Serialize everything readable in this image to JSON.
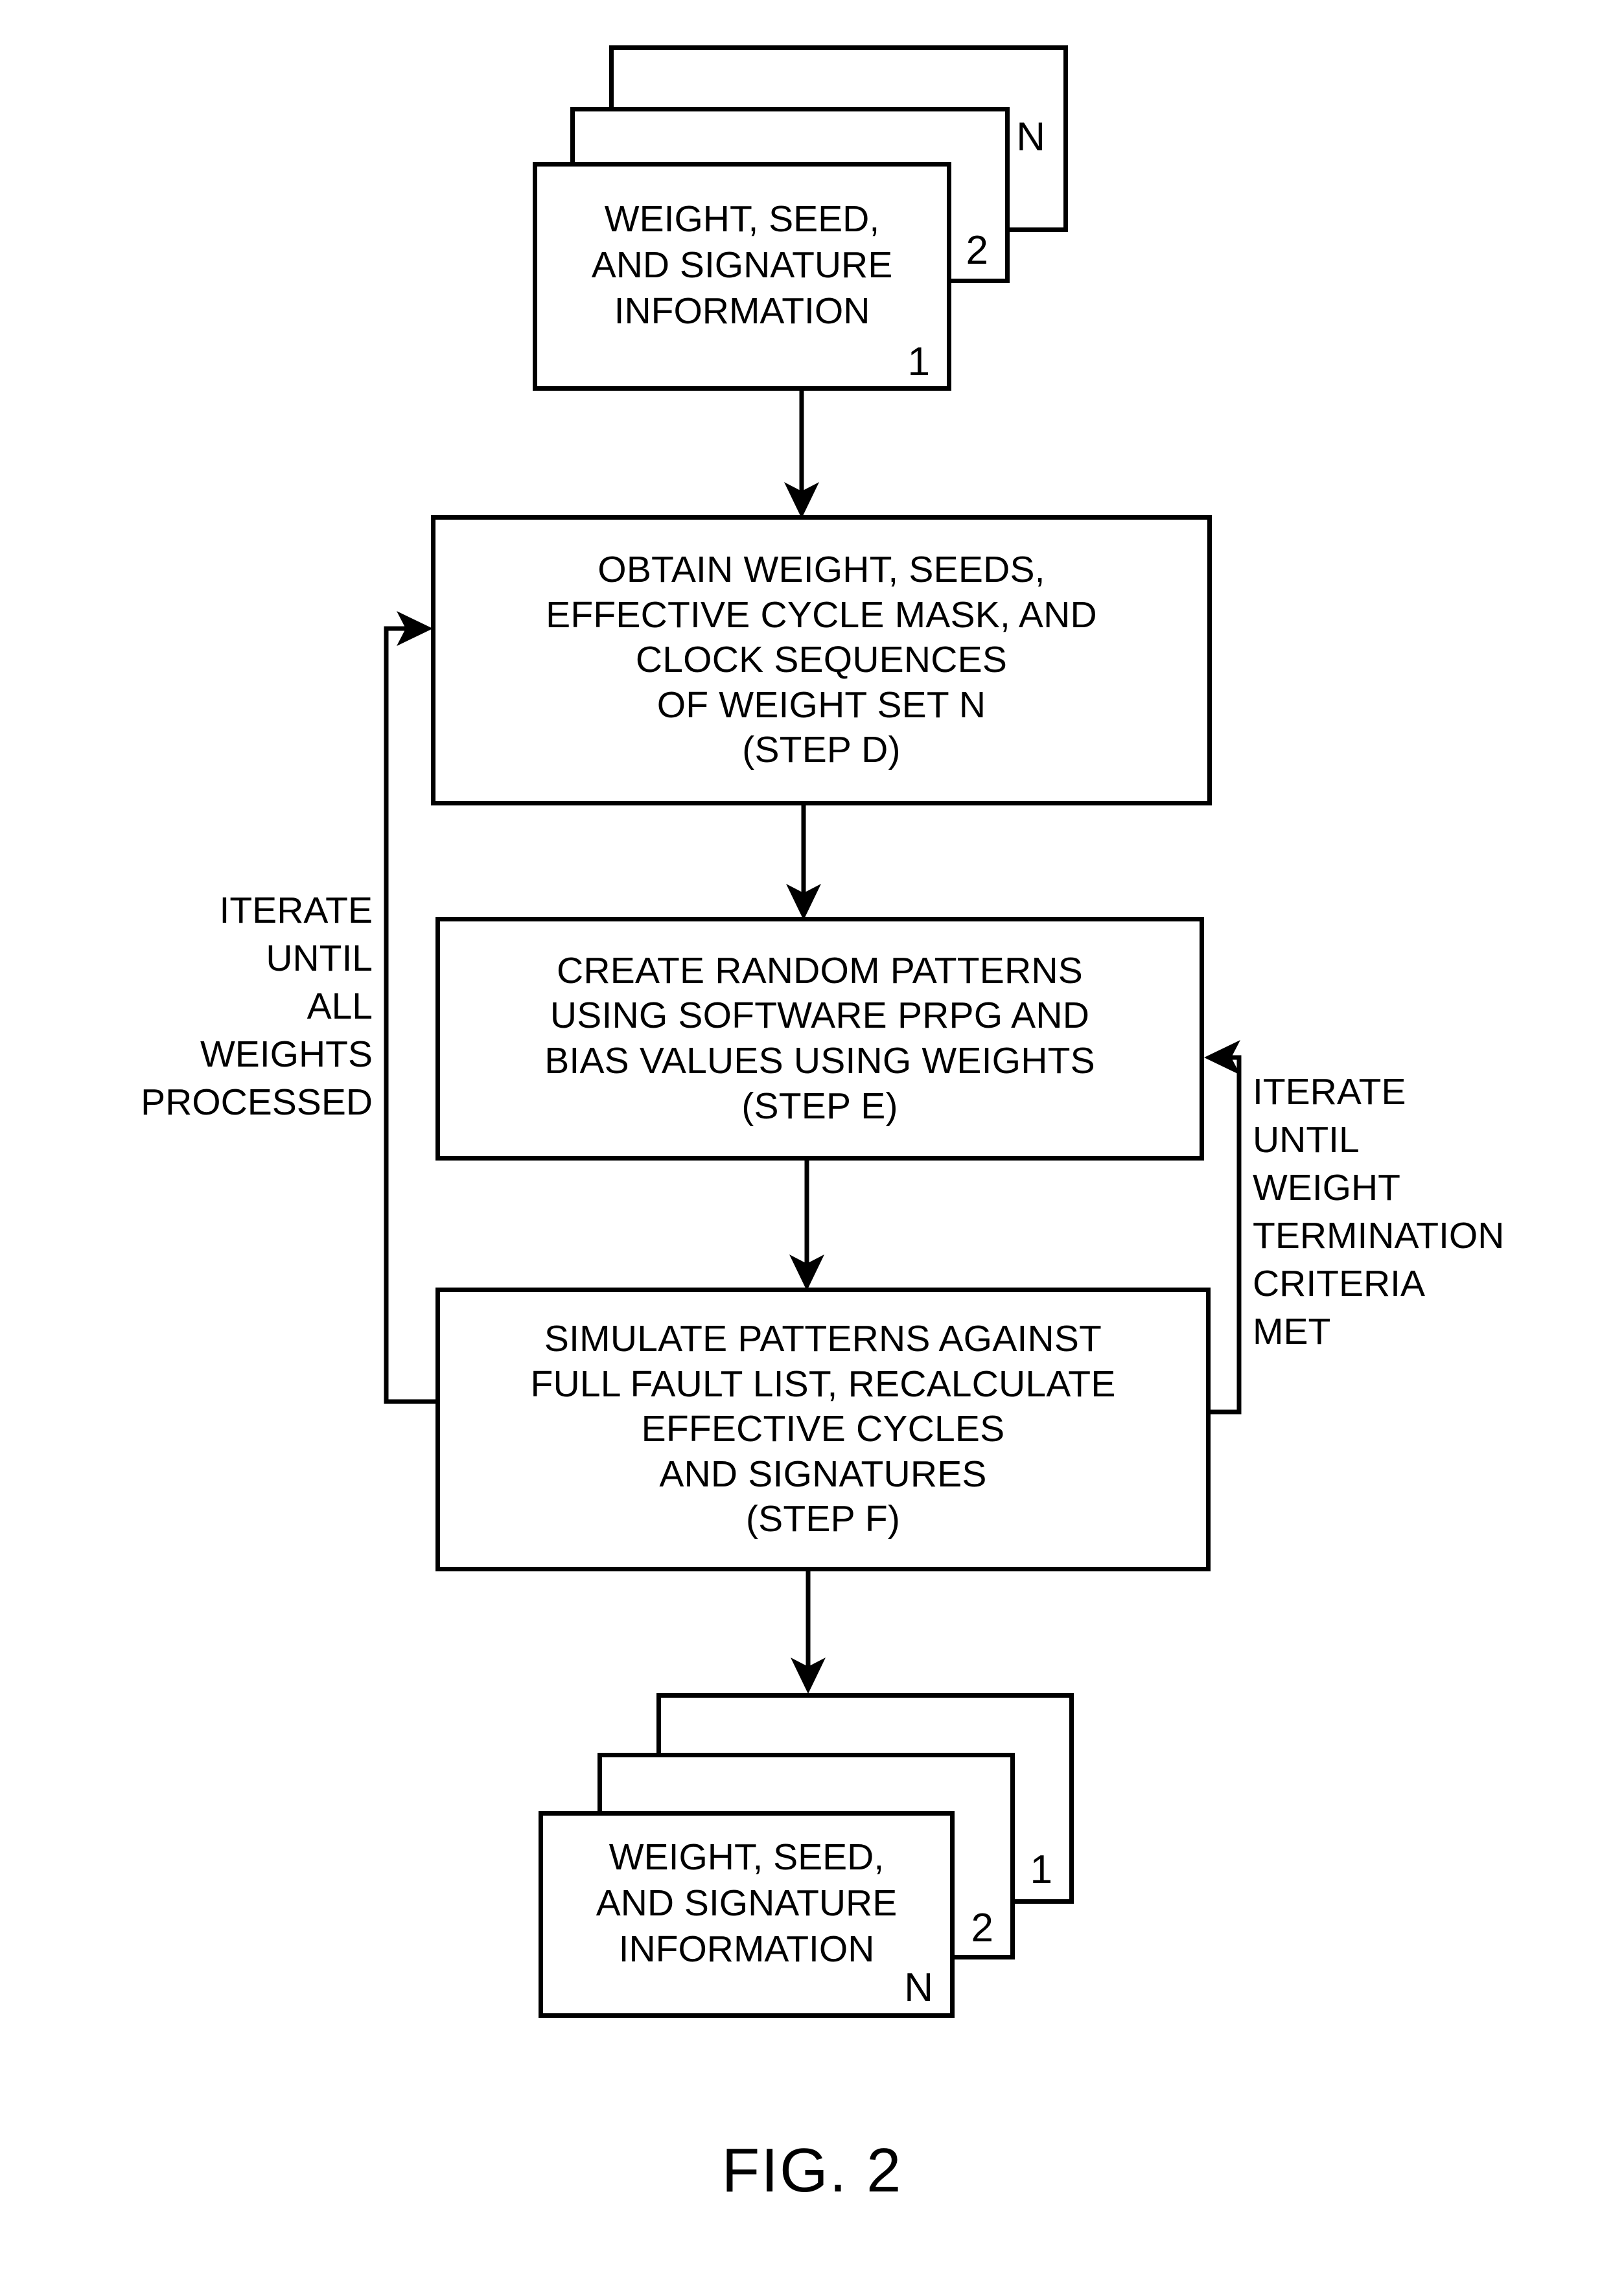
{
  "figure": {
    "caption": "FIG. 2",
    "line_color": "#000000",
    "background": "#ffffff"
  },
  "top_stack": {
    "name": "weight-seed-signature-input-stack",
    "front_text": "WEIGHT, SEED,\nAND SIGNATURE\nINFORMATION",
    "indices": {
      "front": "1",
      "middle": "2",
      "back": "N"
    }
  },
  "bottom_stack": {
    "name": "weight-seed-signature-output-stack",
    "front_text": "WEIGHT, SEED,\nAND SIGNATURE\nINFORMATION",
    "indices": {
      "front": "N",
      "middle": "2",
      "back": "1"
    }
  },
  "steps": [
    {
      "id": "step-d",
      "text": "OBTAIN WEIGHT, SEEDS,\nEFFECTIVE CYCLE MASK, AND\nCLOCK SEQUENCES\nOF WEIGHT SET N\n(STEP D)"
    },
    {
      "id": "step-e",
      "text": "CREATE RANDOM PATTERNS\nUSING SOFTWARE PRPG AND\nBIAS VALUES USING WEIGHTS\n(STEP E)"
    },
    {
      "id": "step-f",
      "text": "SIMULATE PATTERNS AGAINST\nFULL FAULT LIST, RECALCULATE\nEFFECTIVE CYCLES\nAND SIGNATURES\n(STEP F)"
    }
  ],
  "loops": {
    "left": {
      "label": "ITERATE\nUNTIL\nALL\nWEIGHTS\nPROCESSED"
    },
    "right": {
      "label": "ITERATE\nUNTIL\nWEIGHT\nTERMINATION\nCRITERIA\nMET"
    }
  }
}
